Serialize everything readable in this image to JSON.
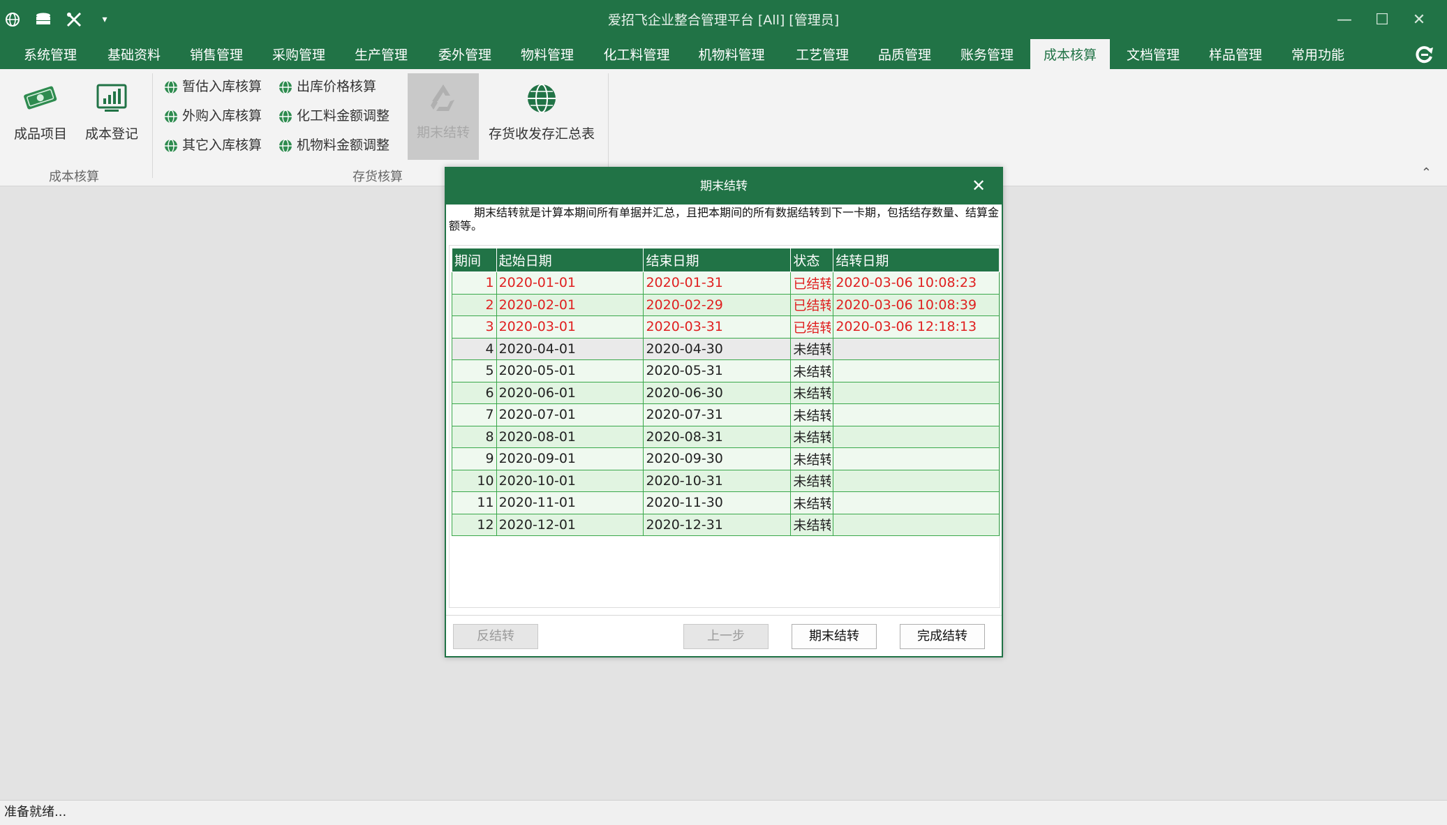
{
  "app": {
    "title": "爱招飞企业整合管理平台 [All] [管理员]",
    "accent_color": "#217346",
    "quick_access": [
      "globe-icon",
      "database-icon",
      "tools-icon",
      "customize-arrow-icon"
    ],
    "window_controls": {
      "minimize": "—",
      "maximize": "☐",
      "close": "✕"
    }
  },
  "menu": {
    "tabs": [
      {
        "label": "系统管理"
      },
      {
        "label": "基础资料"
      },
      {
        "label": "销售管理"
      },
      {
        "label": "采购管理"
      },
      {
        "label": "生产管理"
      },
      {
        "label": "委外管理"
      },
      {
        "label": "物料管理"
      },
      {
        "label": "化工料管理"
      },
      {
        "label": "机物料管理"
      },
      {
        "label": "工艺管理"
      },
      {
        "label": "品质管理"
      },
      {
        "label": "账务管理"
      },
      {
        "label": "成本核算",
        "active": true
      },
      {
        "label": "文档管理"
      },
      {
        "label": "样品管理"
      },
      {
        "label": "常用功能"
      }
    ]
  },
  "ribbon": {
    "cost_group": {
      "label": "成本核算",
      "finished_items": "成品项目",
      "cost_register": "成本登记"
    },
    "inventory_group": {
      "label": "存货核算",
      "estimate_in": "暂估入库核算",
      "purchase_in": "外购入库核算",
      "other_in": "其它入库核算",
      "out_price": "出库价格核算",
      "chem_adjust": "化工料金额调整",
      "mech_adjust": "机物料金额调整",
      "period_close": "期末结转",
      "summary": "存货收发存汇总表"
    }
  },
  "dialog": {
    "title": "期末结转",
    "description": "期末结转就是计算本期间所有单据并汇总，且把本期间的所有数据结转到下一卡期，包括结存数量、结算金额等。",
    "columns": [
      "期间",
      "起始日期",
      "结束日期",
      "状态",
      "结转日期"
    ],
    "rows": [
      {
        "period": "1",
        "start": "2020-01-01",
        "end": "2020-01-31",
        "status": "已结转",
        "closed": "2020-03-06 10:08:23",
        "done": true
      },
      {
        "period": "2",
        "start": "2020-02-01",
        "end": "2020-02-29",
        "status": "已结转",
        "closed": "2020-03-06 10:08:39",
        "done": true
      },
      {
        "period": "3",
        "start": "2020-03-01",
        "end": "2020-03-31",
        "status": "已结转",
        "closed": "2020-03-06 12:18:13",
        "done": true
      },
      {
        "period": "4",
        "start": "2020-04-01",
        "end": "2020-04-30",
        "status": "未结转",
        "closed": "",
        "done": false
      },
      {
        "period": "5",
        "start": "2020-05-01",
        "end": "2020-05-31",
        "status": "未结转",
        "closed": "",
        "done": false
      },
      {
        "period": "6",
        "start": "2020-06-01",
        "end": "2020-06-30",
        "status": "未结转",
        "closed": "",
        "done": false
      },
      {
        "period": "7",
        "start": "2020-07-01",
        "end": "2020-07-31",
        "status": "未结转",
        "closed": "",
        "done": false
      },
      {
        "period": "8",
        "start": "2020-08-01",
        "end": "2020-08-31",
        "status": "未结转",
        "closed": "",
        "done": false
      },
      {
        "period": "9",
        "start": "2020-09-01",
        "end": "2020-09-30",
        "status": "未结转",
        "closed": "",
        "done": false
      },
      {
        "period": "10",
        "start": "2020-10-01",
        "end": "2020-10-31",
        "status": "未结转",
        "closed": "",
        "done": false
      },
      {
        "period": "11",
        "start": "2020-11-01",
        "end": "2020-11-30",
        "status": "未结转",
        "closed": "",
        "done": false
      },
      {
        "period": "12",
        "start": "2020-12-01",
        "end": "2020-12-31",
        "status": "未结转",
        "closed": "",
        "done": false
      }
    ],
    "buttons": {
      "reverse": "反结转",
      "prev": "上一步",
      "close_period": "期末结转",
      "finish": "完成结转"
    }
  },
  "status": {
    "text": "准备就绪..."
  }
}
